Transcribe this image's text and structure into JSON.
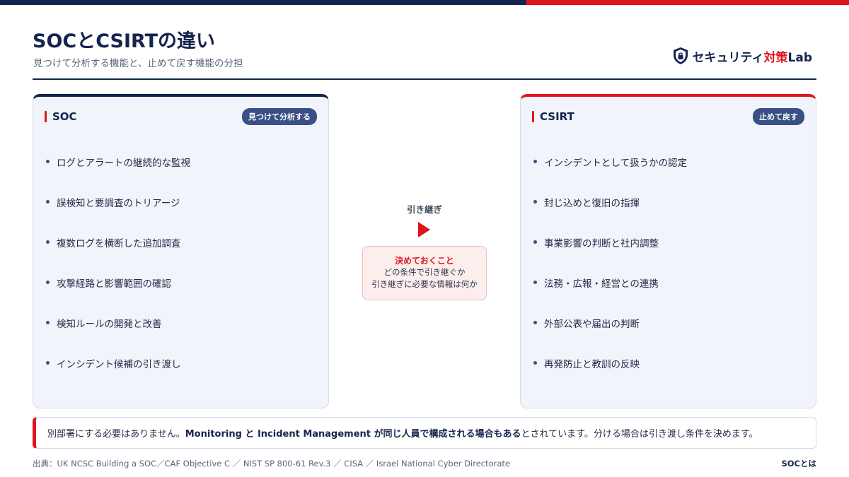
{
  "header": {
    "title": "SOCとCSIRTの違い",
    "subtitle": "見つけて分析する機能と、止めて戻す機能の分担"
  },
  "brand": {
    "prefix": "セキュリティ",
    "accent": "対策",
    "suffix": "Lab",
    "icon": "shield-lock-icon"
  },
  "soc": {
    "name": "SOC",
    "badge": "見つけて分析する",
    "items": [
      "ログとアラートの継続的な監視",
      "誤検知と要調査のトリアージ",
      "複数ログを横断した追加調査",
      "攻撃経路と影響範囲の確認",
      "検知ルールの開発と改善",
      "インシデント候補の引き渡し"
    ]
  },
  "csirt": {
    "name": "CSIRT",
    "badge": "止めて戻す",
    "items": [
      "インシデントとして扱うかの認定",
      "封じ込めと復旧の指揮",
      "事業影響の判断と社内調整",
      "法務・広報・経営との連携",
      "外部公表や届出の判断",
      "再発防止と教訓の反映"
    ]
  },
  "handoff": {
    "label": "引き継ぎ",
    "note_title": "決めておくこと",
    "note_line1": "どの条件で引き継ぐか",
    "note_line2": "引き継ぎに必要な情報は何か"
  },
  "callout": {
    "before": "別部署にする必要はありません。",
    "bold": "Monitoring と Incident Management が同じ人員で構成される場合もある",
    "after": "とされています。分ける場合は引き渡し条件を決めます。"
  },
  "footer": {
    "source": "出典：UK NCSC Building a SOC／CAF Objective C ／ NIST SP 800-61 Rev.3 ／ CISA ／ Israel National Cyber Directorate",
    "page_label": "SOCとは"
  },
  "colors": {
    "navy": "#15244f",
    "red": "#e0141e",
    "badge": "#3a4f86"
  }
}
